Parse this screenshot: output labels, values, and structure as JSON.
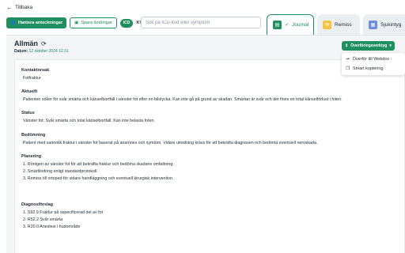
{
  "nav": {
    "back_label": "Tillbaka"
  },
  "toolbar": {
    "hantera_label": "Hantera anteckningar",
    "spara_label": "Spara ändringar",
    "icd_chip": "ICD",
    "kva_label": "KVÅ"
  },
  "search": {
    "placeholder": "Sök på ICD-kod eller symptom"
  },
  "tabs": [
    {
      "label": "Journal",
      "active": true
    },
    {
      "label": "Remiss",
      "active": false
    },
    {
      "label": "Sjukintyg",
      "active": false
    }
  ],
  "header": {
    "title": "Allmän",
    "date_label": "Datum:",
    "date_value": "12 oktober 2024 12:31"
  },
  "transfer": {
    "button_label": "Överföringsverktyg",
    "menu": [
      {
        "label": "Överför till Webdoc",
        "icon": "export-icon"
      },
      {
        "label": "Smart kopiering",
        "icon": "copy-icon"
      }
    ]
  },
  "note": {
    "kontaktorsak": {
      "heading": "Kontaktorsak",
      "text": "Fotfraktur"
    },
    "aktuellt": {
      "heading": "Aktuellt",
      "text": "Patienten söker för svår smärta och känselbortfall i vänster fot efter en bilolycka. Kan inte gå på grund av skadan. Smärtan är svår och det finns en total känselförlust i foten."
    },
    "status": {
      "heading": "Status",
      "text": "Vänster fot: Svår smärta och total känselbortfall. Kan inte belasta foten."
    },
    "bedomning": {
      "heading": "Bedömning",
      "text": "Patient med sannolik fraktur i vänster fot baserat på anamnes och symtom. Vidare utredning krävs för att bekräfta diagnosen och bedöma eventuell nervskada."
    },
    "planering": {
      "heading": "Planering",
      "items": [
        "Röntgen av vänster fot för att bekräfta fraktur och bedöma skadans omfattning.",
        "Smärtlindring enligt standardprotokoll.",
        "Remiss till ortoped för vidare handläggning och eventuell kirurgisk intervention."
      ]
    },
    "diagnos": {
      "heading": "Diagnosförslag",
      "items": [
        "S92.9 Fraktur på ospecificerad del av fot",
        "R52.2 Svår smärta",
        "R20.0 Anestesi i hudområde"
      ]
    }
  },
  "colors": {
    "brand_green": "#1f8f5f",
    "remiss_icon": "#f4c542",
    "sjuk_icon": "#6e8fdc",
    "panel_bg": "#f3f5f7"
  }
}
